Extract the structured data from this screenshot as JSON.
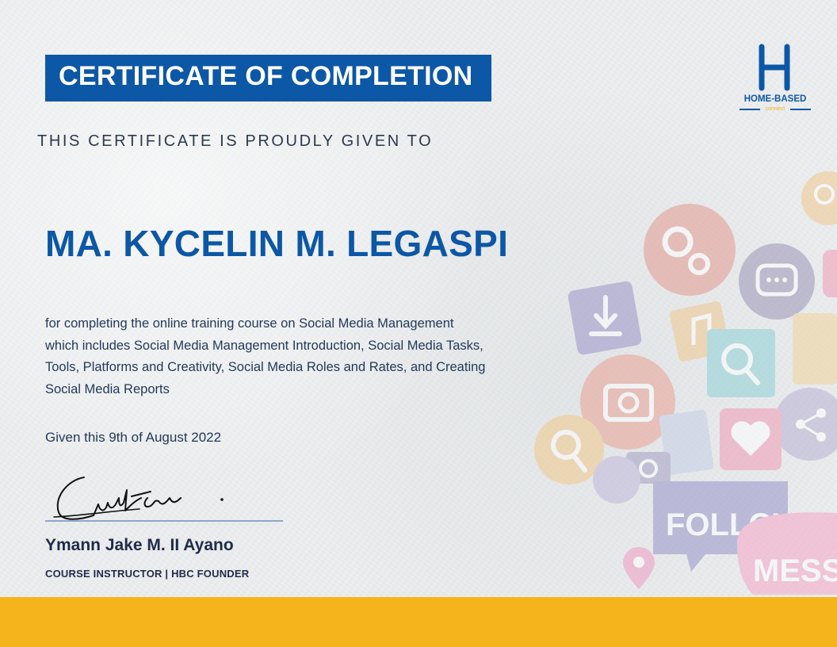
{
  "certificate": {
    "title": "CERTIFICATE OF COMPLETION",
    "given_to_label": "THIS CERTIFICATE IS PROUDLY GIVEN TO",
    "recipient_name": "MA. KYCELIN M. LEGASPI",
    "description_lines": [
      "for completing the online training course on Social Media Management",
      "which includes Social Media Management Introduction, Social Media Tasks,",
      "Tools, Platforms and Creativity, Social Media Roles and Rates, and Creating",
      "Social Media Reports"
    ],
    "date_text": "Given this 9th of August 2022"
  },
  "signer": {
    "name": "Ymann Jake M. II Ayano",
    "role": "COURSE INSTRUCTOR | HBC FOUNDER"
  },
  "logo": {
    "name": "HOME-BASED",
    "sub": "connect"
  },
  "artwork": {
    "follow_label": "FOLLOW",
    "message_label": "MESSAG"
  },
  "colors": {
    "brand_blue": "#0c57a6",
    "accent_yellow": "#f5b41b",
    "text_dark": "#1f2b49"
  },
  "icons": [
    "gears-icon",
    "chat-bubble-icon",
    "download-icon",
    "music-note-icon",
    "magnifier-icon",
    "camera-icon",
    "heart-icon",
    "share-icon",
    "document-icon",
    "location-pin-icon"
  ]
}
